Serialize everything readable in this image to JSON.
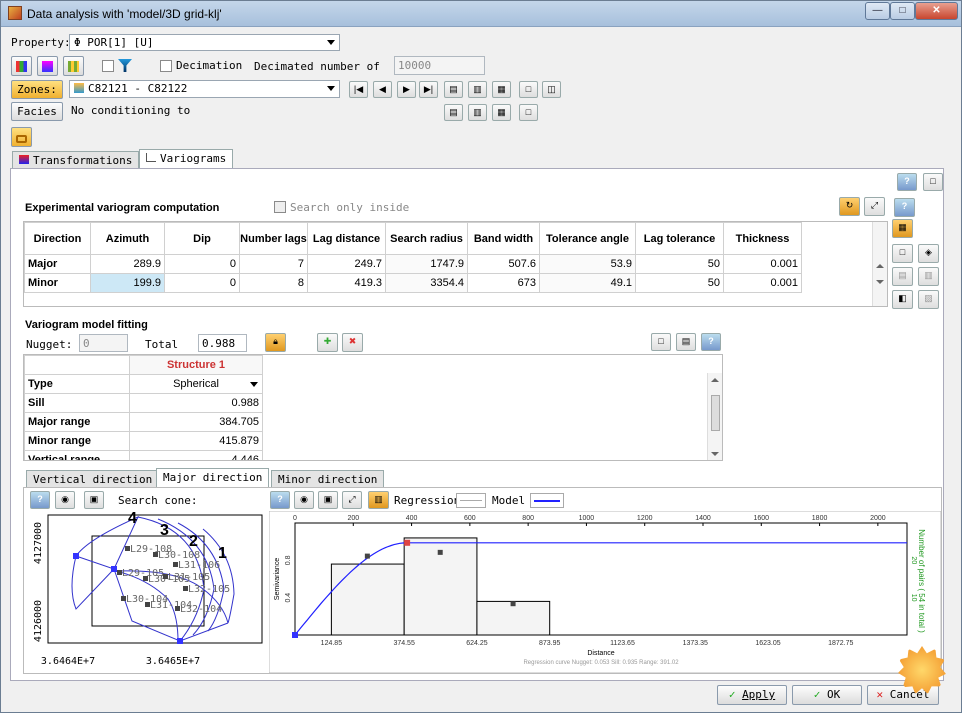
{
  "window": {
    "title": "Data analysis with 'model/3D grid-klj'",
    "min": "—",
    "max": "□",
    "close": "✕"
  },
  "property": {
    "label": "Property:",
    "value": "Φ POR[1] [U]"
  },
  "decimation": {
    "label": "Decimation",
    "decimated_label": "Decimated number of",
    "decimated_value": "10000"
  },
  "zones": {
    "button": "Zones:",
    "value": "C82121 - C82122"
  },
  "facies": {
    "button": "Facies",
    "value": "No conditioning to"
  },
  "tabs": {
    "transformations": "Transformations",
    "variograms": "Variograms"
  },
  "exp": {
    "title": "Experimental variogram computation",
    "search_only": "Search only inside",
    "headers": [
      "Direction",
      "Azimuth",
      "Dip",
      "Number lags",
      "Lag distance",
      "Search radius",
      "Band width",
      "Tolerance angle",
      "Lag tolerance",
      "Thickness"
    ],
    "rows": [
      [
        "Major",
        "289.9",
        "0",
        "7",
        "249.7",
        "1747.9",
        "507.6",
        "53.9",
        "50",
        "0.001"
      ],
      [
        "Minor",
        "199.9",
        "0",
        "8",
        "419.3",
        "3354.4",
        "673",
        "49.1",
        "50",
        "0.001"
      ]
    ]
  },
  "fit": {
    "title": "Variogram model fitting",
    "nugget_label": "Nugget:",
    "nugget_value": "0",
    "total_label": "Total",
    "total_value": "0.988",
    "structure_header": "Structure 1",
    "rows": [
      [
        "Type",
        "Spherical"
      ],
      [
        "Sill",
        "0.988"
      ],
      [
        "Major range",
        "384.705"
      ],
      [
        "Minor range",
        "415.879"
      ],
      [
        "Vertical range",
        "4.446"
      ]
    ]
  },
  "dir_tabs": {
    "vertical": "Vertical direction",
    "major": "Major direction",
    "minor": "Minor direction"
  },
  "map": {
    "search_cone": "Search cone:",
    "y_top": "4127000",
    "y_bottom": "4126000",
    "x_left": "3.6464E+7",
    "x_right": "3.6465E+7",
    "cones": [
      "4",
      "3",
      "2",
      "1"
    ],
    "wells": [
      "L29-108",
      "L30-108",
      "L31-106",
      "L29-105",
      "L30-105",
      "L31-105",
      "L32-105",
      "L30-104",
      "L31-104",
      "L32-104"
    ]
  },
  "legend": {
    "regression": "Regression",
    "model": "Model"
  },
  "chart_data": {
    "type": "bar",
    "xlabel": "Distance",
    "ylabel": "Semivariance",
    "y2label": "Number of pairs ( 54 in total )",
    "top_ticks": [
      "0",
      "200",
      "400",
      "600",
      "800",
      "1000",
      "1200",
      "1400",
      "1600",
      "1800",
      "2000"
    ],
    "bottom_ticks": [
      "124.85",
      "374.55",
      "624.25",
      "873.95",
      "1123.65",
      "1373.35",
      "1623.05",
      "1872.75"
    ],
    "y_ticks": [
      "0.4",
      "0.8"
    ],
    "y2_ticks": [
      "10",
      "20"
    ],
    "xlim": [
      0,
      2100
    ],
    "ylim": [
      0,
      1.2
    ],
    "bars": [
      {
        "from": 124.85,
        "to": 374.55,
        "pairs": 19
      },
      {
        "from": 374.55,
        "to": 624.25,
        "pairs": 26
      },
      {
        "from": 624.25,
        "to": 873.95,
        "pairs": 9
      }
    ],
    "points": [
      {
        "x": 250,
        "y": 0.84
      },
      {
        "x": 500,
        "y": 0.88
      },
      {
        "x": 750,
        "y": 0.33
      }
    ],
    "model": {
      "nugget": 0,
      "sill": 0.988,
      "range": 384.705
    },
    "footer": "Regression curve  Nugget: 0.053  Sill: 0.935  Range: 391.02"
  },
  "buttons": {
    "apply": "Apply",
    "ok": "OK",
    "cancel": "Cancel"
  },
  "colors": {
    "accent": "#c0a0a0",
    "model": "#2020ff",
    "selection": "#cde8f6"
  }
}
